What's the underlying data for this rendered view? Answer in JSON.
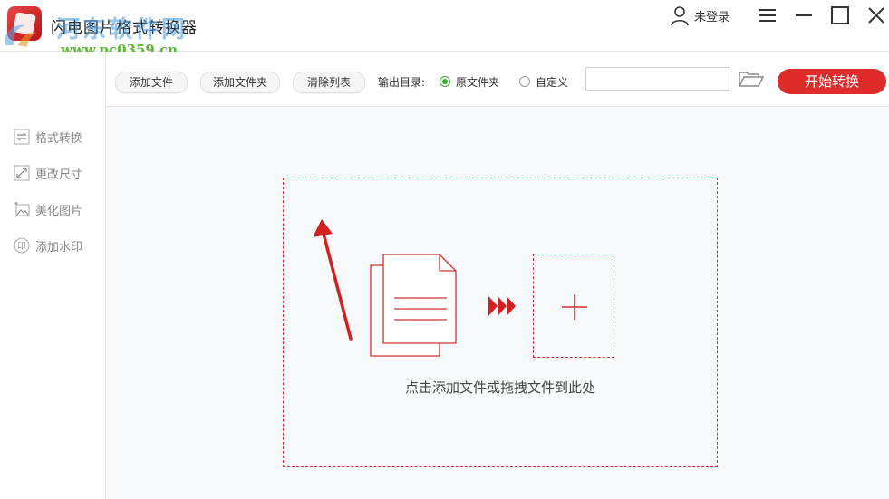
{
  "app": {
    "title": "闪电图片格式转换器"
  },
  "watermark": {
    "site_name": "河东软件网",
    "url": "www.pc0359.cn"
  },
  "header": {
    "user_label": "未登录"
  },
  "toolbar": {
    "add_file": "添加文件",
    "add_folder": "添加文件夹",
    "clear_list": "清除列表",
    "output_label": "输出目录:",
    "option_original": "原文件夹",
    "option_custom": "自定义",
    "selected_option": "原文件夹",
    "path_value": "",
    "start_button": "开始转换"
  },
  "sidebar": {
    "items": [
      {
        "label": "格式转换",
        "icon": "swap-arrows-icon"
      },
      {
        "label": "更改尺寸",
        "icon": "resize-icon"
      },
      {
        "label": "美化图片",
        "icon": "beautify-image-icon"
      },
      {
        "label": "添加水印",
        "icon": "watermark-seal-icon"
      }
    ]
  },
  "main": {
    "drop_hint": "点击添加文件或拖拽文件到此处"
  },
  "colors": {
    "accent_red": "#e02b2b",
    "radio_green": "#3aaa35",
    "drop_border": "#d03030"
  }
}
